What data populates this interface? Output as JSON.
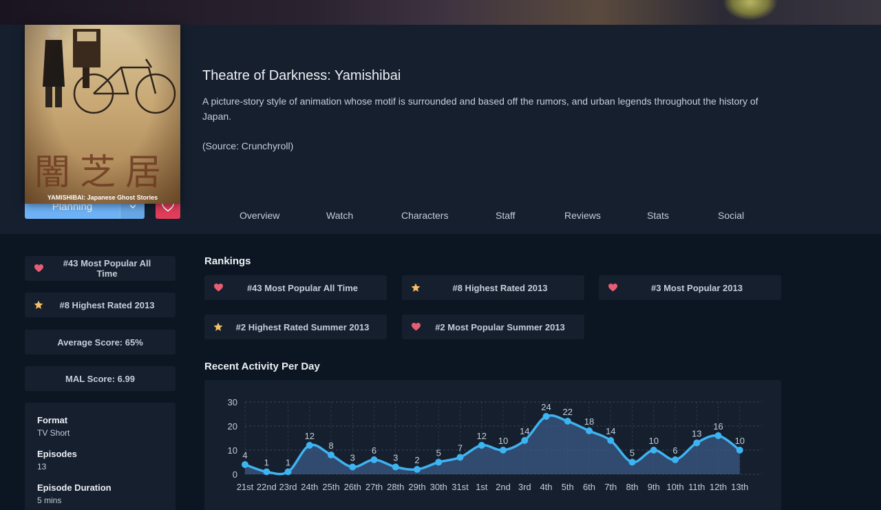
{
  "media": {
    "title": "Theatre of Darkness: Yamishibai",
    "description": "A picture-story style of animation whose motif is surrounded and based off the rumors, and urban legends throughout the history of Japan.",
    "source": "(Source: Crunchyroll)",
    "cover_kanji": "闇芝居",
    "cover_caption": "YAMISHIBAI: Japanese Ghost Stories"
  },
  "actions": {
    "list_status": "Planning"
  },
  "tabs": [
    "Overview",
    "Watch",
    "Characters",
    "Staff",
    "Reviews",
    "Stats",
    "Social"
  ],
  "sidebar": {
    "rankings": [
      {
        "icon": "heart-icon",
        "label": "#43 Most Popular All Time"
      },
      {
        "icon": "star-icon",
        "label": "#8 Highest Rated 2013"
      }
    ],
    "average_score": "Average Score: 65%",
    "mal_score": "MAL Score: 6.99",
    "info": [
      {
        "key": "Format",
        "value": "TV Short"
      },
      {
        "key": "Episodes",
        "value": "13"
      },
      {
        "key": "Episode Duration",
        "value": "5 mins"
      }
    ]
  },
  "rankings_section": {
    "title": "Rankings",
    "items": [
      {
        "icon": "heart-icon",
        "label": "#43 Most Popular All Time"
      },
      {
        "icon": "star-icon",
        "label": "#8 Highest Rated 2013"
      },
      {
        "icon": "heart-icon",
        "label": "#3 Most Popular 2013"
      },
      {
        "icon": "star-icon",
        "label": "#2 Highest Rated Summer 2013"
      },
      {
        "icon": "heart-icon",
        "label": "#2 Most Popular Summer 2013"
      }
    ]
  },
  "activity": {
    "title": "Recent Activity Per Day"
  },
  "colors": {
    "heart": "#e85d75",
    "star": "#f7bf63",
    "line": "#3db4f2",
    "button": "#6fb3f7",
    "fav": "#e23d5a"
  },
  "chart_data": {
    "type": "area",
    "categories": [
      "21st",
      "22nd",
      "23rd",
      "24th",
      "25th",
      "26th",
      "27th",
      "28th",
      "29th",
      "30th",
      "31st",
      "1st",
      "2nd",
      "3rd",
      "4th",
      "5th",
      "6th",
      "7th",
      "8th",
      "9th",
      "10th",
      "11th",
      "12th",
      "13th"
    ],
    "values": [
      4,
      1,
      1,
      12,
      8,
      3,
      6,
      3,
      2,
      5,
      7,
      12,
      10,
      14,
      24,
      22,
      18,
      14,
      5,
      10,
      6,
      13,
      16,
      10
    ],
    "yticks": [
      0,
      10,
      20,
      30
    ],
    "ylim": [
      0,
      30
    ],
    "grid": true
  }
}
